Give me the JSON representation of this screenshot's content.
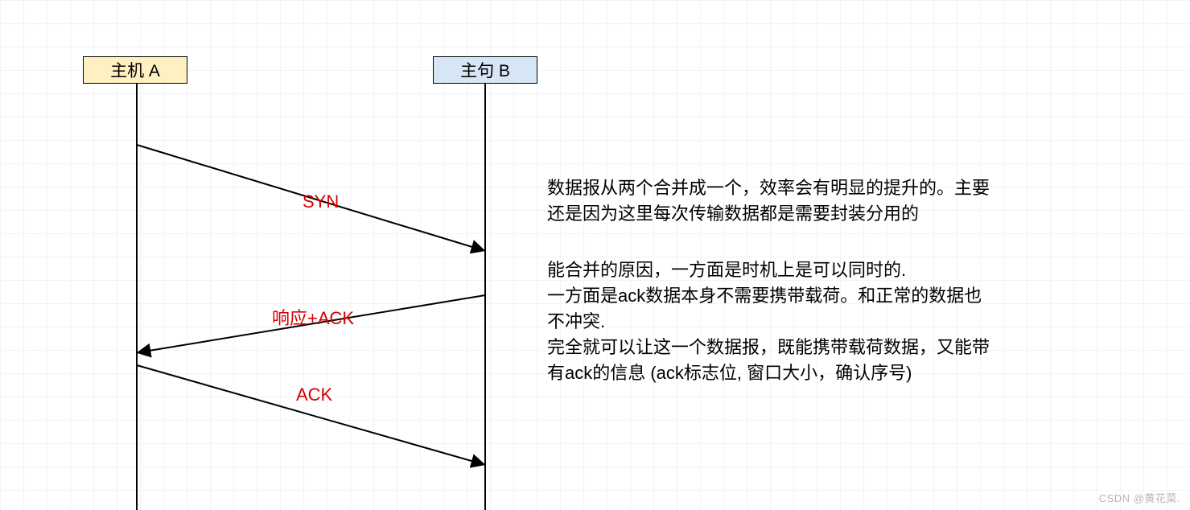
{
  "hosts": {
    "a": "主机 A",
    "b": "主句 B"
  },
  "messages": {
    "syn": "SYN",
    "resp_ack": "响应+ACK",
    "ack": "ACK"
  },
  "paragraphs": {
    "p1": "数据报从两个合并成一个，效率会有明显的提升的。主要还是因为这里每次传输数据都是需要封装分用的",
    "p2": "能合并的原因，一方面是时机上是可以同时的.\n一方面是ack数据本身不需要携带载荷。和正常的数据也不冲突.\n完全就可以让这一个数据报，既能携带载荷数据，又能带有ack的信息 (ack标志位, 窗口大小，确认序号)"
  },
  "watermark": "CSDN @黄花菜."
}
